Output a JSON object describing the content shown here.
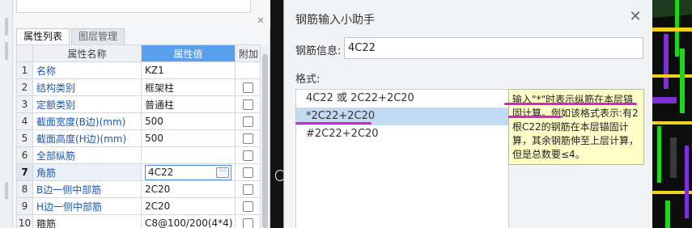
{
  "property_panel": {
    "tabs": [
      {
        "label": "属性列表",
        "active": true
      },
      {
        "label": "图层管理",
        "active": false
      }
    ],
    "columns": {
      "index": "",
      "name": "属性名称",
      "value": "属性值",
      "add": "附加"
    },
    "rows": [
      {
        "index": "1",
        "name": "名称",
        "value": "KZ1",
        "name_style": "link",
        "checkbox": false
      },
      {
        "index": "2",
        "name": "结构类别",
        "value": "框架柱",
        "name_style": "link",
        "checkbox": true
      },
      {
        "index": "3",
        "name": "定额类别",
        "value": "普通柱",
        "name_style": "link",
        "checkbox": true
      },
      {
        "index": "4",
        "name": "截面宽度(B边)(mm)",
        "value": "500",
        "name_style": "link",
        "checkbox": true
      },
      {
        "index": "5",
        "name": "截面高度(H边)(mm)",
        "value": "500",
        "name_style": "link",
        "checkbox": true
      },
      {
        "index": "6",
        "name": "全部纵筋",
        "value": "",
        "name_style": "link",
        "checkbox": true
      },
      {
        "index": "7",
        "name": "角筋",
        "value": "4C22",
        "name_style": "link",
        "checkbox": true,
        "selected": true
      },
      {
        "index": "8",
        "name": "B边一侧中部筋",
        "value": "2C20",
        "name_style": "link",
        "checkbox": true
      },
      {
        "index": "9",
        "name": "H边一侧中部筋",
        "value": "2C20",
        "name_style": "link",
        "checkbox": true
      },
      {
        "index": "10",
        "name": "箍筋",
        "value": "C8@100/200(4*4)",
        "name_style": "plain",
        "checkbox": true
      }
    ],
    "ellipsis": "···"
  },
  "dialog": {
    "title": "钢筋输入小助手",
    "close": "✕",
    "info_label": "钢筋信息:",
    "info_value": "4C22",
    "format_label": "格式:",
    "formats": [
      "4C22 或 2C22+2C20",
      "*2C22+2C20",
      "#2C22+2C20"
    ],
    "selected_format_index": 1,
    "hint_text": "输入\"*\"时表示纵筋在本层锚固计算。例如该格式表示:有2根C22的钢筋在本层锚固计算，其余钢筋伸至上层计算，但是总数要≤4。"
  },
  "colors": {
    "accent": "#5aa0ef",
    "link": "#1a57b8",
    "annotation": "#e01fcf",
    "hint_bg": "#ffffc8",
    "selection": "#c4d9f2"
  }
}
